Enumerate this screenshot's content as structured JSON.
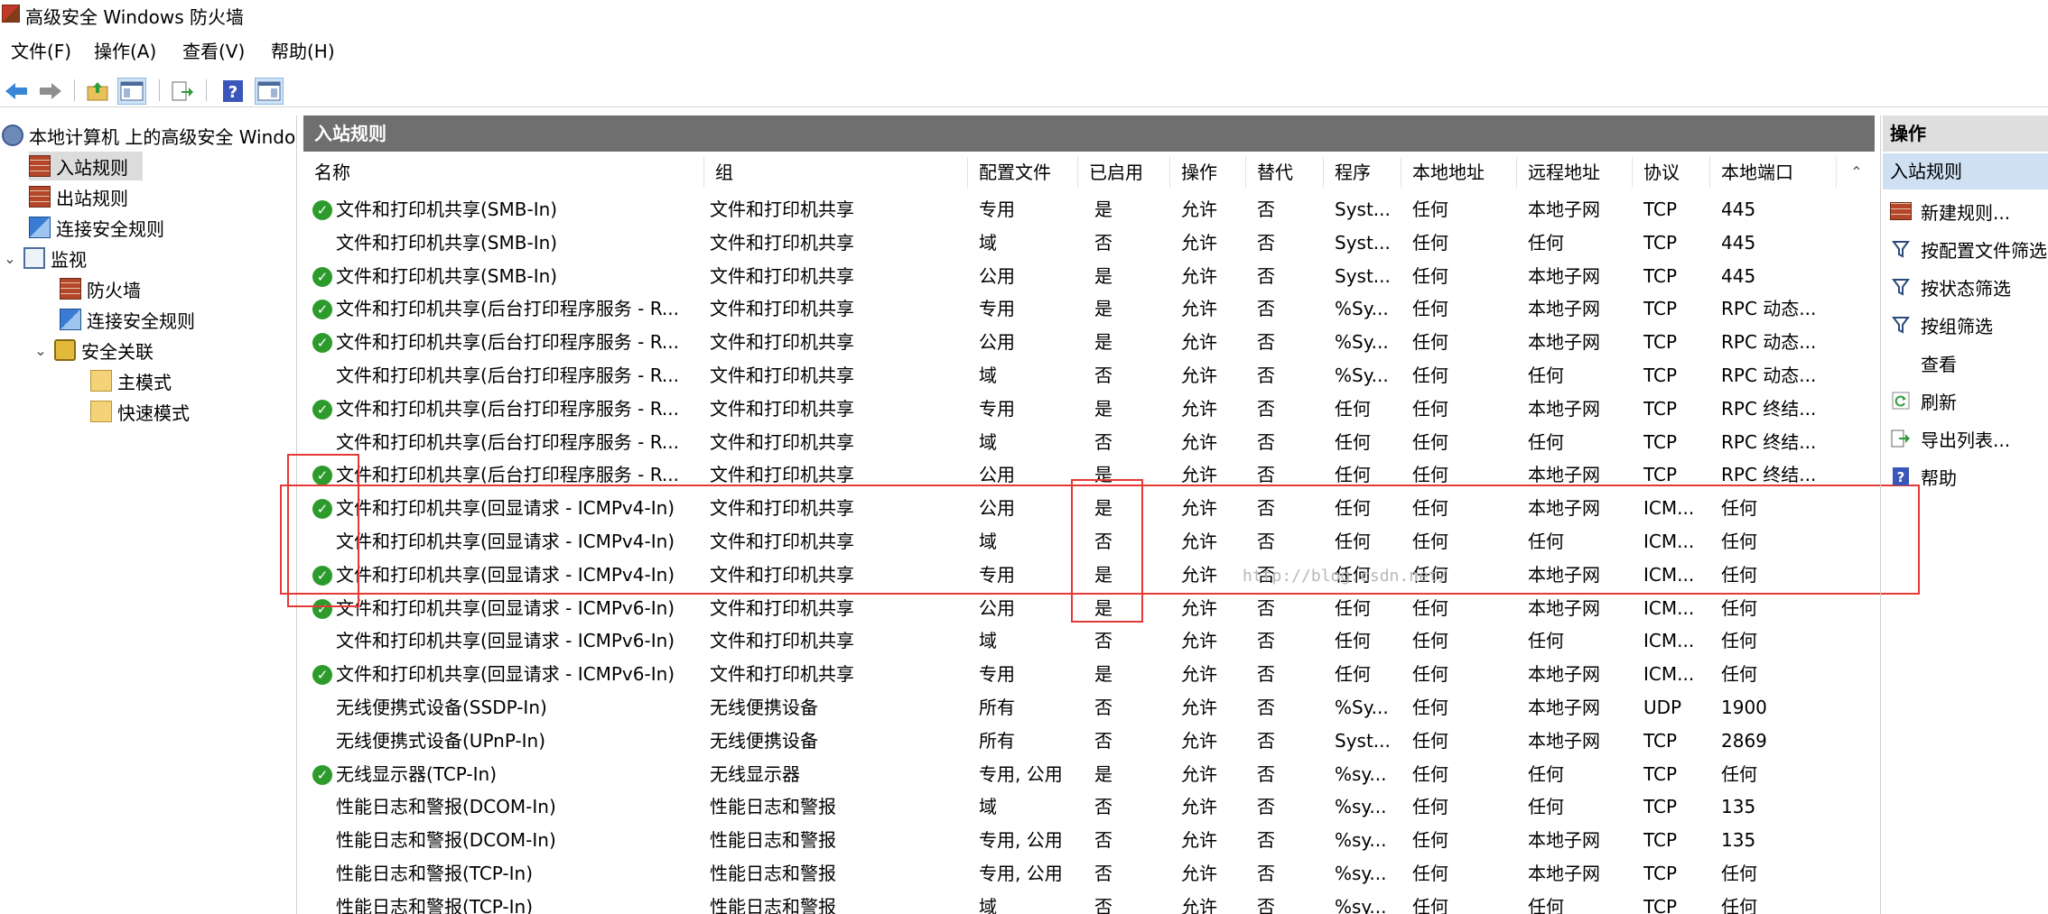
{
  "window": {
    "title": "高级安全 Windows 防火墙"
  },
  "menu": [
    {
      "label": "文件(F)"
    },
    {
      "label": "操作(A)"
    },
    {
      "label": "查看(V)"
    },
    {
      "label": "帮助(H)"
    }
  ],
  "toolbar": {
    "buttons": [
      "back-arrow-icon",
      "forward-arrow-icon",
      "up-folder-icon",
      "show-tree-icon",
      "export-icon",
      "help-icon",
      "show-action-pane-icon"
    ]
  },
  "tree": {
    "root": "本地计算机 上的高级安全 Windows",
    "inbound": "入站规则",
    "outbound": "出站规则",
    "connection_security": "连接安全规则",
    "monitor": "监视",
    "firewall": "防火墙",
    "monitor_connection_security": "连接安全规则",
    "security_associations": "安全关联",
    "main_mode": "主模式",
    "quick_mode": "快速模式"
  },
  "center": {
    "header": "入站规则",
    "columns": [
      "名称",
      "组",
      "配置文件",
      "已启用",
      "操作",
      "替代",
      "程序",
      "本地地址",
      "远程地址",
      "协议",
      "本地端口"
    ],
    "rows": [
      {
        "enabled": true,
        "name": "文件和打印机共享(SMB-In)",
        "group": "文件和打印机共享",
        "profile": "专用",
        "enabled_text": "是",
        "action": "允许",
        "override": "否",
        "program": "Syst...",
        "local": "任何",
        "remote": "本地子网",
        "protocol": "TCP",
        "port": "445"
      },
      {
        "enabled": false,
        "name": "文件和打印机共享(SMB-In)",
        "group": "文件和打印机共享",
        "profile": "域",
        "enabled_text": "否",
        "action": "允许",
        "override": "否",
        "program": "Syst...",
        "local": "任何",
        "remote": "任何",
        "protocol": "TCP",
        "port": "445"
      },
      {
        "enabled": true,
        "name": "文件和打印机共享(SMB-In)",
        "group": "文件和打印机共享",
        "profile": "公用",
        "enabled_text": "是",
        "action": "允许",
        "override": "否",
        "program": "Syst...",
        "local": "任何",
        "remote": "本地子网",
        "protocol": "TCP",
        "port": "445"
      },
      {
        "enabled": true,
        "name": "文件和打印机共享(后台打印程序服务 - R...",
        "group": "文件和打印机共享",
        "profile": "专用",
        "enabled_text": "是",
        "action": "允许",
        "override": "否",
        "program": "%Sy...",
        "local": "任何",
        "remote": "本地子网",
        "protocol": "TCP",
        "port": "RPC 动态..."
      },
      {
        "enabled": true,
        "name": "文件和打印机共享(后台打印程序服务 - R...",
        "group": "文件和打印机共享",
        "profile": "公用",
        "enabled_text": "是",
        "action": "允许",
        "override": "否",
        "program": "%Sy...",
        "local": "任何",
        "remote": "本地子网",
        "protocol": "TCP",
        "port": "RPC 动态..."
      },
      {
        "enabled": false,
        "name": "文件和打印机共享(后台打印程序服务 - R...",
        "group": "文件和打印机共享",
        "profile": "域",
        "enabled_text": "否",
        "action": "允许",
        "override": "否",
        "program": "%Sy...",
        "local": "任何",
        "remote": "任何",
        "protocol": "TCP",
        "port": "RPC 动态..."
      },
      {
        "enabled": true,
        "name": "文件和打印机共享(后台打印程序服务 - R...",
        "group": "文件和打印机共享",
        "profile": "专用",
        "enabled_text": "是",
        "action": "允许",
        "override": "否",
        "program": "任何",
        "local": "任何",
        "remote": "本地子网",
        "protocol": "TCP",
        "port": "RPC 终结..."
      },
      {
        "enabled": false,
        "name": "文件和打印机共享(后台打印程序服务 - R...",
        "group": "文件和打印机共享",
        "profile": "域",
        "enabled_text": "否",
        "action": "允许",
        "override": "否",
        "program": "任何",
        "local": "任何",
        "remote": "任何",
        "protocol": "TCP",
        "port": "RPC 终结..."
      },
      {
        "enabled": true,
        "name": "文件和打印机共享(后台打印程序服务 - R...",
        "group": "文件和打印机共享",
        "profile": "公用",
        "enabled_text": "是",
        "action": "允许",
        "override": "否",
        "program": "任何",
        "local": "任何",
        "remote": "本地子网",
        "protocol": "TCP",
        "port": "RPC 终结..."
      },
      {
        "enabled": true,
        "name": "文件和打印机共享(回显请求 - ICMPv4-In)",
        "group": "文件和打印机共享",
        "profile": "公用",
        "enabled_text": "是",
        "action": "允许",
        "override": "否",
        "program": "任何",
        "local": "任何",
        "remote": "本地子网",
        "protocol": "ICM...",
        "port": "任何"
      },
      {
        "enabled": false,
        "name": "文件和打印机共享(回显请求 - ICMPv4-In)",
        "group": "文件和打印机共享",
        "profile": "域",
        "enabled_text": "否",
        "action": "允许",
        "override": "否",
        "program": "任何",
        "local": "任何",
        "remote": "任何",
        "protocol": "ICM...",
        "port": "任何"
      },
      {
        "enabled": true,
        "name": "文件和打印机共享(回显请求 - ICMPv4-In)",
        "group": "文件和打印机共享",
        "profile": "专用",
        "enabled_text": "是",
        "action": "允许",
        "override": "否",
        "program": "任何",
        "local": "任何",
        "remote": "本地子网",
        "protocol": "ICM...",
        "port": "任何"
      },
      {
        "enabled": true,
        "name": "文件和打印机共享(回显请求 - ICMPv6-In)",
        "group": "文件和打印机共享",
        "profile": "公用",
        "enabled_text": "是",
        "action": "允许",
        "override": "否",
        "program": "任何",
        "local": "任何",
        "remote": "本地子网",
        "protocol": "ICM...",
        "port": "任何"
      },
      {
        "enabled": false,
        "name": "文件和打印机共享(回显请求 - ICMPv6-In)",
        "group": "文件和打印机共享",
        "profile": "域",
        "enabled_text": "否",
        "action": "允许",
        "override": "否",
        "program": "任何",
        "local": "任何",
        "remote": "任何",
        "protocol": "ICM...",
        "port": "任何"
      },
      {
        "enabled": true,
        "name": "文件和打印机共享(回显请求 - ICMPv6-In)",
        "group": "文件和打印机共享",
        "profile": "专用",
        "enabled_text": "是",
        "action": "允许",
        "override": "否",
        "program": "任何",
        "local": "任何",
        "remote": "本地子网",
        "protocol": "ICM...",
        "port": "任何"
      },
      {
        "enabled": false,
        "name": "无线便携式设备(SSDP-In)",
        "group": "无线便携设备",
        "profile": "所有",
        "enabled_text": "否",
        "action": "允许",
        "override": "否",
        "program": "%Sy...",
        "local": "任何",
        "remote": "本地子网",
        "protocol": "UDP",
        "port": "1900"
      },
      {
        "enabled": false,
        "name": "无线便携式设备(UPnP-In)",
        "group": "无线便携设备",
        "profile": "所有",
        "enabled_text": "否",
        "action": "允许",
        "override": "否",
        "program": "Syst...",
        "local": "任何",
        "remote": "本地子网",
        "protocol": "TCP",
        "port": "2869"
      },
      {
        "enabled": true,
        "name": "无线显示器(TCP-In)",
        "group": "无线显示器",
        "profile": "专用, 公用",
        "enabled_text": "是",
        "action": "允许",
        "override": "否",
        "program": "%sy...",
        "local": "任何",
        "remote": "任何",
        "protocol": "TCP",
        "port": "任何"
      },
      {
        "enabled": false,
        "name": "性能日志和警报(DCOM-In)",
        "group": "性能日志和警报",
        "profile": "域",
        "enabled_text": "否",
        "action": "允许",
        "override": "否",
        "program": "%sy...",
        "local": "任何",
        "remote": "任何",
        "protocol": "TCP",
        "port": "135"
      },
      {
        "enabled": false,
        "name": "性能日志和警报(DCOM-In)",
        "group": "性能日志和警报",
        "profile": "专用, 公用",
        "enabled_text": "否",
        "action": "允许",
        "override": "否",
        "program": "%sy...",
        "local": "任何",
        "remote": "本地子网",
        "protocol": "TCP",
        "port": "135"
      },
      {
        "enabled": false,
        "name": "性能日志和警报(TCP-In)",
        "group": "性能日志和警报",
        "profile": "专用, 公用",
        "enabled_text": "否",
        "action": "允许",
        "override": "否",
        "program": "%sy...",
        "local": "任何",
        "remote": "本地子网",
        "protocol": "TCP",
        "port": "任何"
      },
      {
        "enabled": false,
        "name": "性能日志和警报(TCP-In)",
        "group": "性能日志和警报",
        "profile": "域",
        "enabled_text": "否",
        "action": "允许",
        "override": "否",
        "program": "%sy...",
        "local": "任何",
        "remote": "任何",
        "protocol": "TCP",
        "port": "任何"
      }
    ],
    "watermark": "http://blog.csdn.net/"
  },
  "actions": {
    "header": "操作",
    "subheader": "入站规则",
    "items": [
      {
        "label": "新建规则...",
        "icon": "new-rule-icon"
      },
      {
        "label": "按配置文件筛选",
        "icon": "filter-icon"
      },
      {
        "label": "按状态筛选",
        "icon": "filter-icon"
      },
      {
        "label": "按组筛选",
        "icon": "filter-icon"
      },
      {
        "label": "查看",
        "icon": "view-icon"
      },
      {
        "label": "刷新",
        "icon": "refresh-icon"
      },
      {
        "label": "导出列表...",
        "icon": "export-icon"
      },
      {
        "label": "帮助",
        "icon": "help-icon"
      }
    ]
  },
  "colors": {
    "header_bar": "#6f6f6f",
    "enabled_check": "#2c9b2c",
    "annotation_red": "#e53935",
    "selection": "#cfe0f3"
  }
}
